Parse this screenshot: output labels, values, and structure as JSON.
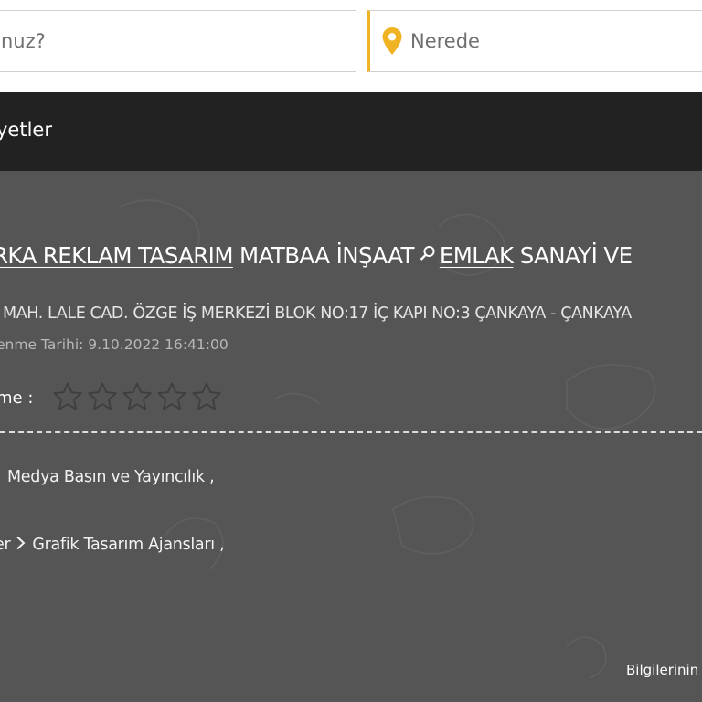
{
  "search": {
    "what_text": "nuz?",
    "where_placeholder": "Nerede"
  },
  "nav": {
    "item": "yetler"
  },
  "company": {
    "title_link1": "RKA REKLAM TASARIM",
    "title_mid": " MATBAA İNŞAAT",
    "title_link2": "EMLAK",
    "title_rest": " SANAYİ VE",
    "address": "MAH. LALE CAD. ÖZGE İŞ MERKEZİ BLOK NO:17 İÇ KAPI NO:3 ÇANKAYA - ÇANKAYA",
    "update_date": "enme Tarihi: 9.10.2022 16:41:00",
    "rating_label": "me :",
    "rating_value": 0,
    "rating_max": 5
  },
  "categories": {
    "line1": "Medya Basın ve Yayıncılık ,",
    "line2_prefix": "er",
    "line2_item": "Grafik Tasarım Ajansları ,"
  },
  "footer": {
    "info_link": "Bilgilerinin"
  },
  "colors": {
    "accent": "#f0b323",
    "navbar_bg": "#222222",
    "content_bg": "#555555",
    "star_outline": "#3e3e3e"
  }
}
